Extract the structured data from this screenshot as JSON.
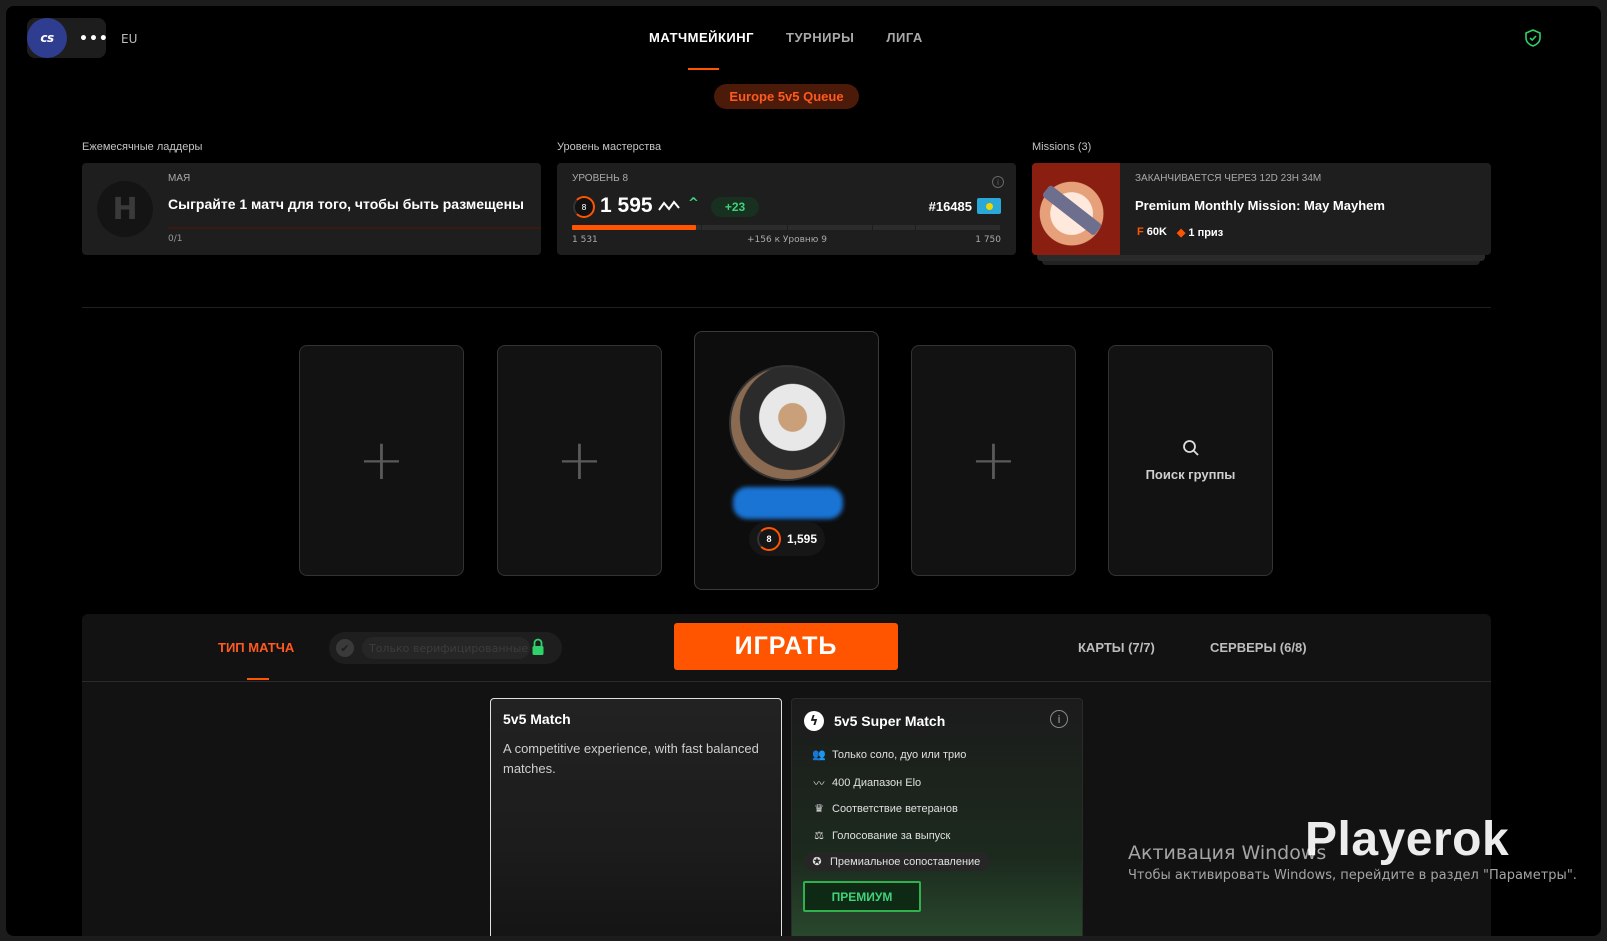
{
  "topbar": {
    "game_logo": "cs",
    "more_icon": "•••",
    "region": "EU",
    "nav": [
      {
        "label": "МАТЧМЕЙКИНГ",
        "active": true
      },
      {
        "label": "ТУРНИРЫ",
        "active": false
      },
      {
        "label": "ЛИГА",
        "active": false
      }
    ],
    "queue_badge": "Europe 5v5 Queue"
  },
  "ladder": {
    "section_title": "Ежемесячные ладдеры",
    "month": "МАЯ",
    "text": "Сыграйте 1 матч для того, чтобы быть размещены",
    "progress": "0/1"
  },
  "mastery": {
    "section_title": "Уровень мастерства",
    "level_label": "УРОВЕНЬ 8",
    "level": "8",
    "elo": "1 595",
    "delta": "+23",
    "rank": "#16485",
    "min": "1 531",
    "to_next": "+156 к Уровню 9",
    "max": "1 750",
    "progress_fraction": 0.29
  },
  "missions": {
    "section_title": "Missions (3)",
    "ends": "ЗАКАНЧИВАЕТСЯ ЧЕРЕЗ 12D 23H 34M",
    "title": "Premium Monthly Mission: May Mayhem",
    "reward_points": "60K",
    "reward_prize": "1 приз"
  },
  "party": {
    "me_elo": "1,595",
    "me_level": "8",
    "search_label": "Поиск группы"
  },
  "panel": {
    "match_type_tab": "ТИП МАТЧА",
    "verified_placeholder": "Только верифицированные",
    "play_label": "ИГРАТЬ",
    "maps_tab": "КАРТЫ (7/7)",
    "servers_tab": "СЕРВЕРЫ (6/8)"
  },
  "match_cards": {
    "standard": {
      "title": "5v5 Match",
      "description": "A competitive experience, with fast balanced matches."
    },
    "super": {
      "title": "5v5 Super Match",
      "features": [
        "Только соло, дуо или трио",
        "400 Диапазон Elo",
        "Соответствие ветеранов",
        "Голосование за выпуск",
        "Премиальное сопоставление"
      ],
      "premium_button": "ПРЕМИУМ"
    }
  },
  "overlays": {
    "windows_title": "Активация Windows",
    "windows_sub": "Чтобы активировать Windows, перейдите в раздел \"Параметры\".",
    "watermark": "Playerok"
  },
  "colors": {
    "accent": "#ff5500",
    "positive": "#3ed27a",
    "background": "#000000",
    "card": "#1e1e1e"
  }
}
